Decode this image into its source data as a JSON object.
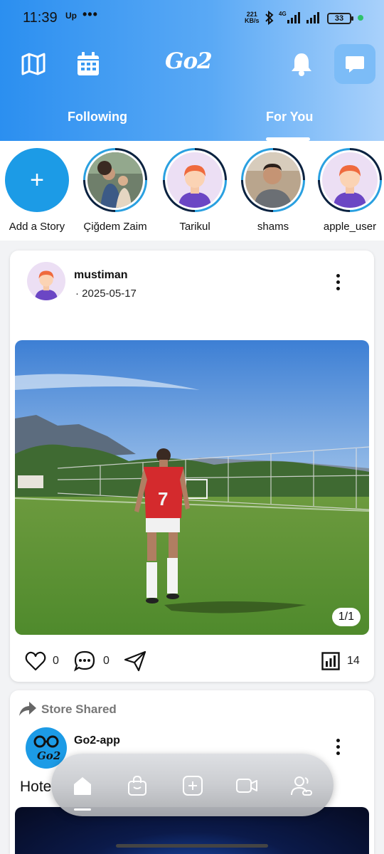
{
  "status_bar": {
    "time": "11:39",
    "carrier_badge": "Up",
    "more": "•••",
    "speed_value": "221",
    "speed_unit": "KB/s",
    "network": "4G",
    "battery": "33"
  },
  "header": {
    "logo": "Go2",
    "tabs": [
      {
        "label": "Following"
      },
      {
        "label": "For You",
        "active": true
      }
    ]
  },
  "stories": [
    {
      "name": "Add a Story",
      "type": "add"
    },
    {
      "name": "Çiğdem Zaim",
      "type": "photo"
    },
    {
      "name": "Tarikul",
      "type": "default-avatar"
    },
    {
      "name": "shams",
      "type": "photo"
    },
    {
      "name": "apple_user",
      "type": "default-avatar"
    }
  ],
  "post": {
    "username": "mustiman",
    "date": "· 2025-05-17",
    "photo_counter": "1/1",
    "likes": "0",
    "comments": "0",
    "views": "14"
  },
  "shared_post": {
    "label": "Store Shared",
    "store_name": "Go2-app",
    "avatar_text": "Go2",
    "title": "Hote"
  },
  "bottom_nav": [
    {
      "name": "home",
      "active": true
    },
    {
      "name": "shop"
    },
    {
      "name": "create"
    },
    {
      "name": "video"
    },
    {
      "name": "friends"
    }
  ],
  "colors": {
    "accent": "#1c9be6",
    "header_start": "#2b8ff0",
    "header_end": "#a9d1fb"
  }
}
